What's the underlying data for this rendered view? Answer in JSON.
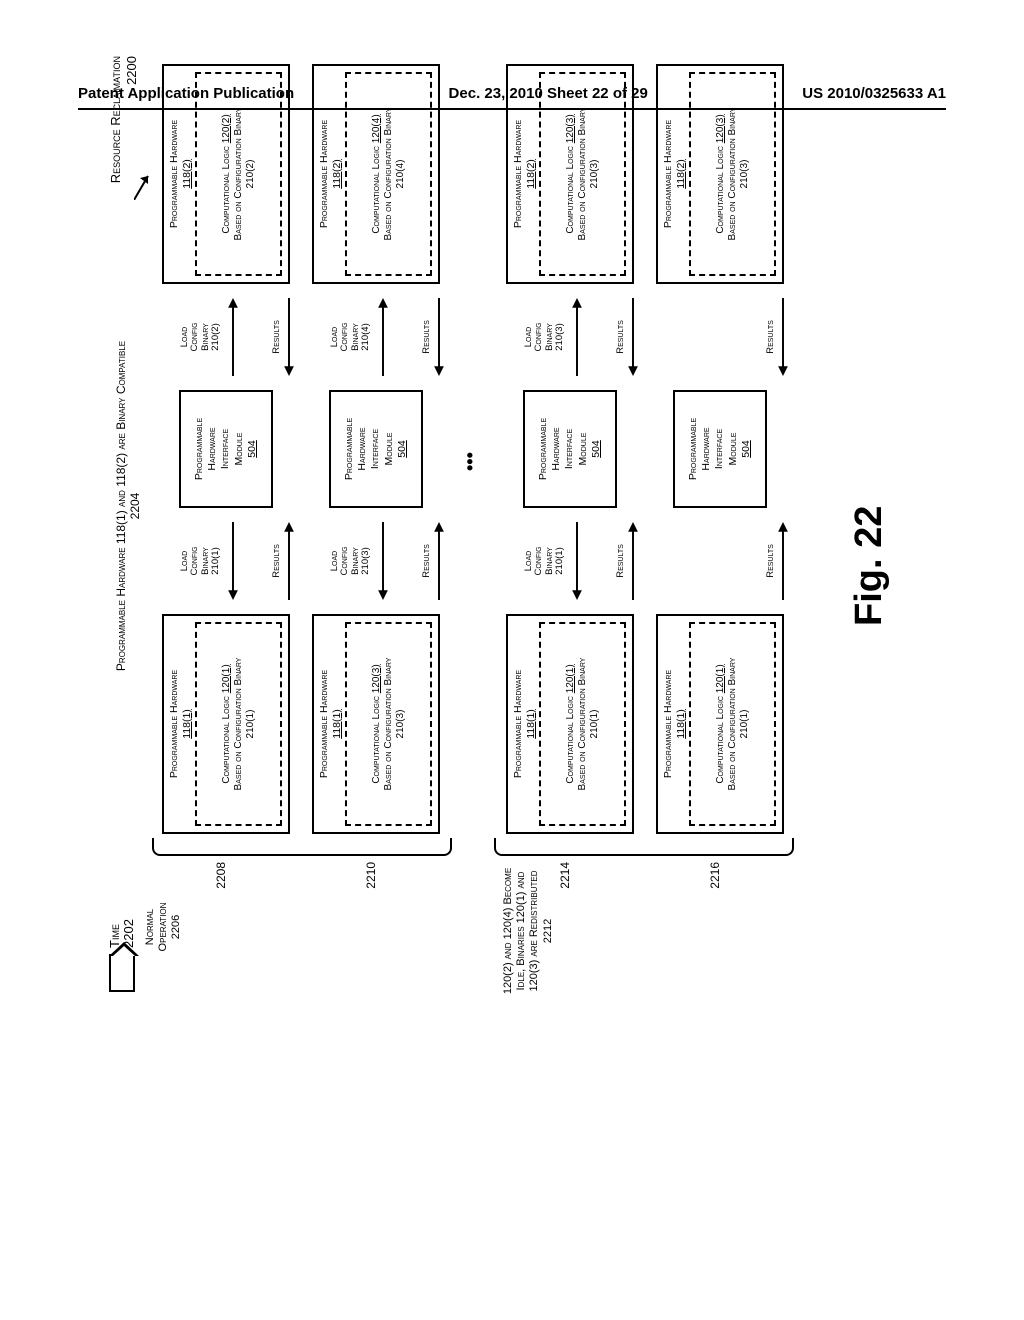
{
  "header": {
    "left": "Patent Application Publication",
    "center": "Dec. 23, 2010  Sheet 22 of 29",
    "right": "US 2010/0325633 A1"
  },
  "figure_label": "Fig. 22",
  "time": {
    "label": "Time",
    "ref": "2202"
  },
  "top_compat": {
    "line1": "Programmable Hardware 118(1) and 118(2) are Binary Compatible",
    "ref": "2204"
  },
  "top_title": {
    "line1": "Resource Reclaimation",
    "ref": "2200"
  },
  "group_labels": {
    "g1": {
      "line1": "Normal",
      "line2": "Operation",
      "ref": "2206"
    },
    "g2": {
      "line1": "120(2) and 120(4) Become Idle, Binaries 120(1) and 120(3) are Redistributed",
      "ref": "2212"
    }
  },
  "row_refs": {
    "r1": "2208",
    "r2": "2210",
    "r3": "2214",
    "r4": "2216"
  },
  "ellipsis": "•••",
  "phw": {
    "title": "Programmable Hardware",
    "h1": "118(1)",
    "h2": "118(2)"
  },
  "inner": {
    "title_prefix": "Computational Logic ",
    "line2": "Based on Configuration Binary",
    "cl_120_1": "120(1)",
    "cl_120_2": "120(2)",
    "cl_120_3": "120(3)",
    "cl_120_4": "120(4)",
    "cb_210_1": "210(1)",
    "cb_210_2": "210(2)",
    "cb_210_3": "210(3)",
    "cb_210_4": "210(4)"
  },
  "iface": {
    "l1": "Programmable",
    "l2": "Hardware",
    "l3": "Interface",
    "l4": "Module",
    "ref": "504"
  },
  "mid": {
    "load_l1": "Load",
    "load_l2": "Config",
    "load_l3": "Binary",
    "results": "Results",
    "b_210_1": "210(1)",
    "b_210_2": "210(2)",
    "b_210_3": "210(3)",
    "b_210_4": "210(4)"
  }
}
